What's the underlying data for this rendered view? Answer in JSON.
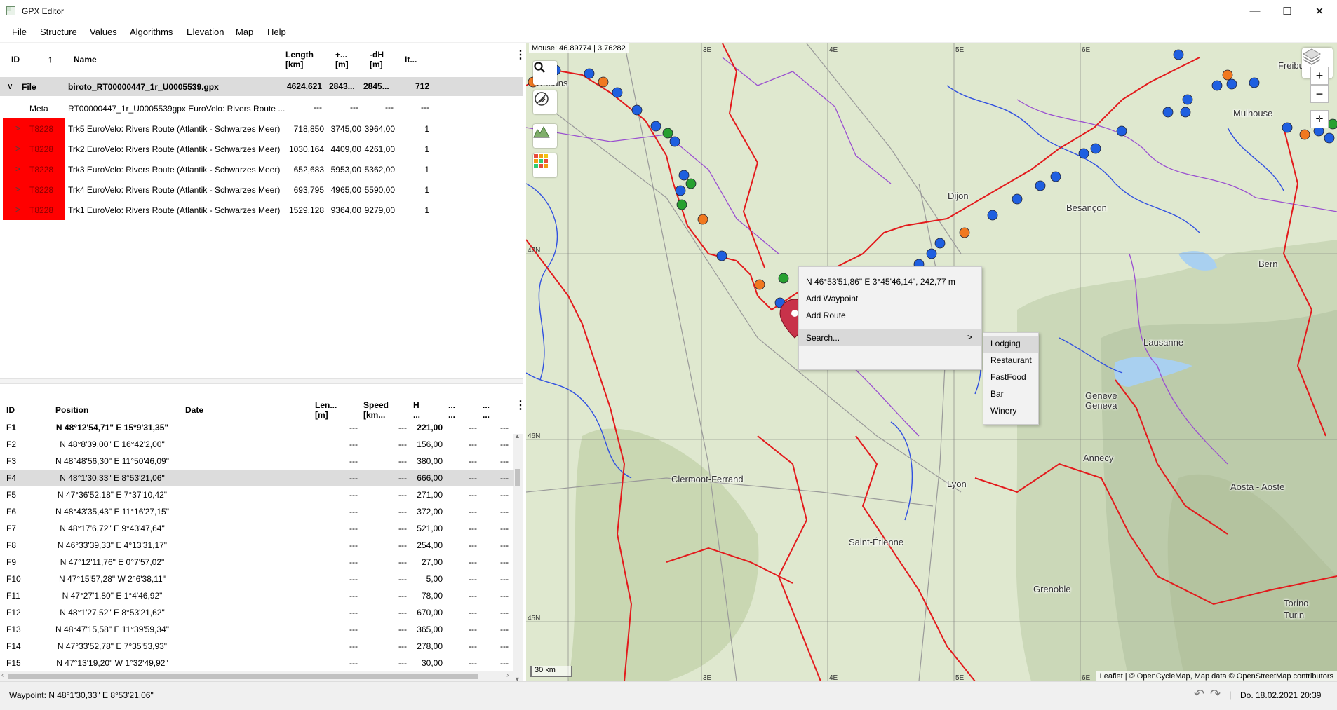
{
  "window": {
    "title": "GPX Editor",
    "minimize": "—",
    "maximize": "☐",
    "close": "✕"
  },
  "menu": [
    "File",
    "Structure",
    "Values",
    "Algorithms",
    "Elevation",
    "Map",
    "Help"
  ],
  "tree": {
    "headers": {
      "id": "ID",
      "sort": "↑",
      "name": "Name",
      "length": "Length\n[km]",
      "up": "+...\n[m]",
      "dh": "-dH\n[m]",
      "it": "It..."
    },
    "file": {
      "expander": "∨",
      "label": "File",
      "name": "biroto_RT00000447_1r_U0005539.gpx",
      "length": "4624,621",
      "up": "2843...",
      "dh": "2845...",
      "it": "712"
    },
    "meta": {
      "label": "Meta",
      "name": "RT00000447_1r_U0005539gpx EuroVelo: Rivers Route ...",
      "length": "---",
      "up": "---",
      "dh": "---",
      "it": "---"
    },
    "tracks": [
      {
        "id": "T8228",
        "name": "Trk5 EuroVelo: Rivers Route (Atlantik - Schwarzes Meer)",
        "length": "718,850",
        "up": "3745,00",
        "dh": "3964,00",
        "it": "1"
      },
      {
        "id": "T8228",
        "name": "Trk2 EuroVelo: Rivers Route (Atlantik - Schwarzes Meer)",
        "length": "1030,164",
        "up": "4409,00",
        "dh": "4261,00",
        "it": "1"
      },
      {
        "id": "T8228",
        "name": "Trk3 EuroVelo: Rivers Route (Atlantik - Schwarzes Meer)",
        "length": "652,683",
        "up": "5953,00",
        "dh": "5362,00",
        "it": "1"
      },
      {
        "id": "T8228",
        "name": "Trk4 EuroVelo: Rivers Route (Atlantik - Schwarzes Meer)",
        "length": "693,795",
        "up": "4965,00",
        "dh": "5590,00",
        "it": "1"
      },
      {
        "id": "T8228",
        "name": "Trk1 EuroVelo: Rivers Route (Atlantik - Schwarzes Meer)",
        "length": "1529,128",
        "up": "9364,00",
        "dh": "9279,00",
        "it": "1"
      }
    ],
    "arrow": ">"
  },
  "points": {
    "headers": {
      "id": "ID",
      "position": "Position",
      "date": "Date",
      "len": "Len...\n[m]",
      "speed": "Speed\n[km...",
      "h": "H\n...",
      "c1": "...\n...",
      "c2": "...\n..."
    },
    "rows": [
      {
        "id": "F1",
        "pos": "N 48°12'54,71\" E 15°9'31,35\"",
        "len": "---",
        "speed": "---",
        "h": "221,00",
        "c1": "---",
        "c2": "---"
      },
      {
        "id": "F2",
        "pos": "N 48°8'39,00\" E 16°42'2,00\"",
        "len": "---",
        "speed": "---",
        "h": "156,00",
        "c1": "---",
        "c2": "---"
      },
      {
        "id": "F3",
        "pos": "N 48°48'56,30\" E 11°50'46,09\"",
        "len": "---",
        "speed": "---",
        "h": "380,00",
        "c1": "---",
        "c2": "---"
      },
      {
        "id": "F4",
        "pos": "N 48°1'30,33\" E 8°53'21,06\"",
        "len": "---",
        "speed": "---",
        "h": "666,00",
        "c1": "---",
        "c2": "---"
      },
      {
        "id": "F5",
        "pos": "N 47°36'52,18\" E 7°37'10,42\"",
        "len": "---",
        "speed": "---",
        "h": "271,00",
        "c1": "---",
        "c2": "---"
      },
      {
        "id": "F6",
        "pos": "N 48°43'35,43\" E 11°16'27,15\"",
        "len": "---",
        "speed": "---",
        "h": "372,00",
        "c1": "---",
        "c2": "---"
      },
      {
        "id": "F7",
        "pos": "N 48°17'6,72\" E 9°43'47,64\"",
        "len": "---",
        "speed": "---",
        "h": "521,00",
        "c1": "---",
        "c2": "---"
      },
      {
        "id": "F8",
        "pos": "N 46°33'39,33\" E 4°13'31,17\"",
        "len": "---",
        "speed": "---",
        "h": "254,00",
        "c1": "---",
        "c2": "---"
      },
      {
        "id": "F9",
        "pos": "N 47°12'11,76\" E 0°7'57,02\"",
        "len": "---",
        "speed": "---",
        "h": "27,00",
        "c1": "---",
        "c2": "---"
      },
      {
        "id": "F10",
        "pos": "N 47°15'57,28\" W 2°6'38,11\"",
        "len": "---",
        "speed": "---",
        "h": "5,00",
        "c1": "---",
        "c2": "---"
      },
      {
        "id": "F11",
        "pos": "N 47°27'1,80\" E 1°4'46,92\"",
        "len": "---",
        "speed": "---",
        "h": "78,00",
        "c1": "---",
        "c2": "---"
      },
      {
        "id": "F12",
        "pos": "N 48°1'27,52\" E 8°53'21,62\"",
        "len": "---",
        "speed": "---",
        "h": "670,00",
        "c1": "---",
        "c2": "---"
      },
      {
        "id": "F13",
        "pos": "N 48°47'15,58\" E 11°39'59,34\"",
        "len": "---",
        "speed": "---",
        "h": "365,00",
        "c1": "---",
        "c2": "---"
      },
      {
        "id": "F14",
        "pos": "N 47°33'52,78\" E 7°35'53,93\"",
        "len": "---",
        "speed": "---",
        "h": "278,00",
        "c1": "---",
        "c2": "---"
      },
      {
        "id": "F15",
        "pos": "N 47°13'19,20\" W 1°32'49,92\"",
        "len": "---",
        "speed": "---",
        "h": "30,00",
        "c1": "---",
        "c2": "---"
      }
    ],
    "selected_id": "F4"
  },
  "map": {
    "mouse": "Mouse: 46.89774 | 3.76282",
    "zoom_in": "+",
    "zoom_out": "−",
    "scale": "30 km",
    "attribution": "Leaflet | © OpenCycleMap, Map data © OpenStreetMap contributors",
    "grid_labels": [
      "3E",
      "4E",
      "5E",
      "6E",
      "3E",
      "4E",
      "5E",
      "6E",
      "47N",
      "46N",
      "45N"
    ],
    "cities": [
      "Dijon",
      "Besançon",
      "Mulhouse",
      "Freibu",
      "Bern",
      "Lausanne",
      "Geneve\nGeneva",
      "Annecy",
      "Lyon",
      "Clermont-Ferrand",
      "Saint-Étienne",
      "Grenoble",
      "Aosta - Aoste",
      "Torino\nTurin",
      "Orléans"
    ],
    "icons": [
      "search-icon",
      "measure-icon",
      "elevation-chart-icon",
      "heatmap-icon",
      "layers-icon",
      "locate-icon"
    ]
  },
  "context_menu": {
    "coords": "N 46°53'51,86\" E 3°45'46,14\", 242,77 m",
    "add_waypoint": "Add Waypoint",
    "add_route": "Add Route",
    "search": "Search...",
    "submenu_arrow": ">",
    "submenu": [
      "Lodging",
      "Restaurant",
      "FastFood",
      "Bar",
      "Winery"
    ]
  },
  "status": {
    "text": "Waypoint: N 48°1'30,33\" E 8°53'21,06\"",
    "undo": "↶",
    "redo": "↷",
    "separator": "|",
    "datetime": "Do. 18.02.2021 20:39"
  },
  "colors": {
    "track_red": "#e31a1c",
    "river_blue": "#3050e0",
    "border_purple": "#9a4fd0",
    "selection": "#dcdcdc",
    "track_id_bg": "#ff0000"
  }
}
